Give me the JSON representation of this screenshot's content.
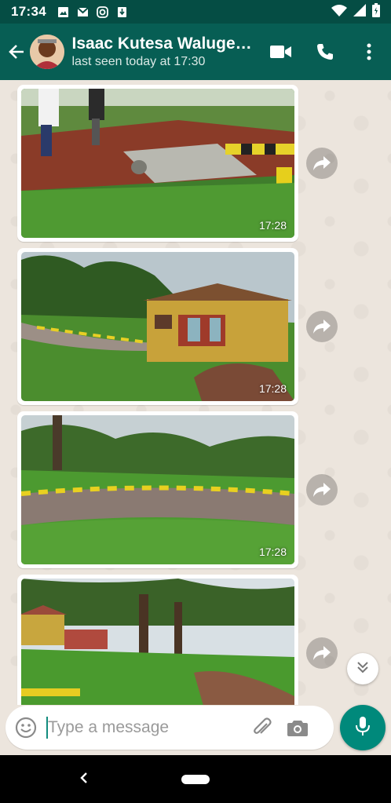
{
  "status_bar": {
    "time": "17:34",
    "icons": [
      "image-icon",
      "gmail-icon",
      "instagram-icon",
      "download-icon",
      "wifi-icon",
      "signal-icon",
      "battery-icon"
    ]
  },
  "header": {
    "contact_name": "Isaac Kutesa Waluge…",
    "last_seen": "last seen today at 17:30",
    "actions": [
      "video-call-icon",
      "voice-call-icon",
      "more-options-icon"
    ]
  },
  "messages": [
    {
      "type": "image",
      "scene": "construction-site",
      "time": "17:28"
    },
    {
      "type": "image",
      "scene": "yellow-house",
      "time": "17:28"
    },
    {
      "type": "image",
      "scene": "curb-road",
      "time": "17:28"
    },
    {
      "type": "image",
      "scene": "trees-houses",
      "time": ""
    }
  ],
  "composer": {
    "placeholder": "Type a message"
  },
  "colors": {
    "header": "#075e54",
    "status_bar": "#054d44",
    "chat_bg": "#ece5dd",
    "accent": "#00897b"
  }
}
